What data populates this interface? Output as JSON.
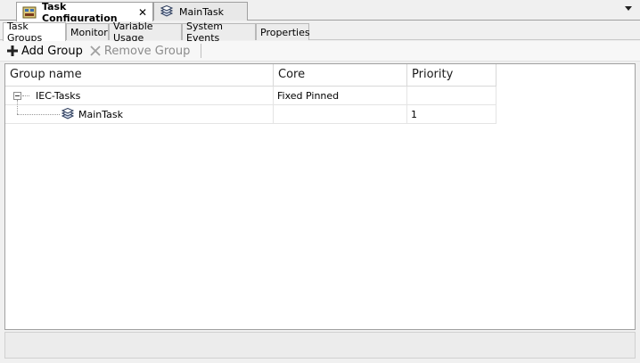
{
  "doc_tabs": [
    {
      "label": "Task Configuration",
      "icon": "task-configuration-icon",
      "active": true,
      "closable": true
    },
    {
      "label": "MainTask",
      "icon": "task-stack-icon",
      "active": false
    }
  ],
  "sub_tabs": [
    {
      "label": "Task Groups",
      "active": true
    },
    {
      "label": "Monitor"
    },
    {
      "label": "Variable Usage"
    },
    {
      "label": "System Events"
    },
    {
      "label": "Properties"
    }
  ],
  "toolbar": {
    "add_group_label": "Add Group",
    "remove_group_label": "Remove Group"
  },
  "grid": {
    "columns": [
      "Group name",
      "Core",
      "Priority"
    ],
    "rows": [
      {
        "name": "IEC-Tasks",
        "core": "Fixed Pinned",
        "priority": "",
        "expanded": true
      },
      {
        "name": "MainTask",
        "core": "",
        "priority": "1"
      }
    ]
  },
  "colors": {
    "background": "#f0f0f0",
    "panel": "#ffffff",
    "border": "#a0a0a0",
    "disabled_text": "#8c8c8c"
  }
}
